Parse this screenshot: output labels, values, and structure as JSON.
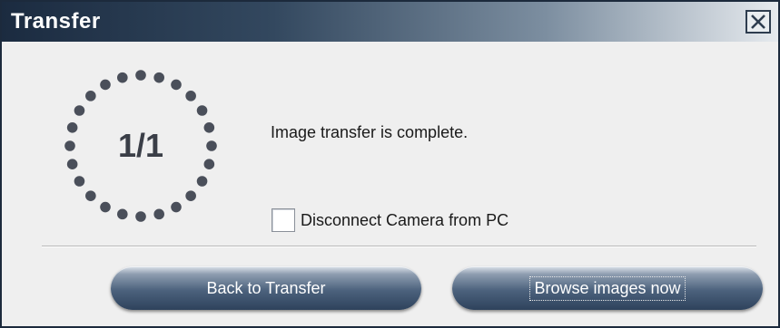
{
  "window": {
    "title": "Transfer"
  },
  "icons": {
    "close": "close-icon"
  },
  "progress": {
    "counter_text": "1/1",
    "completed": 1,
    "total": 1,
    "dot_color": "#4a4f5a"
  },
  "message": "Image transfer is complete.",
  "disconnect_option": {
    "label": "Disconnect Camera from PC",
    "checked": false
  },
  "buttons": {
    "back_label": "Back to Transfer",
    "browse_label": "Browse images now"
  },
  "colors": {
    "title_bar_dark": "#1b2b40",
    "button_dark": "#2e425c"
  }
}
